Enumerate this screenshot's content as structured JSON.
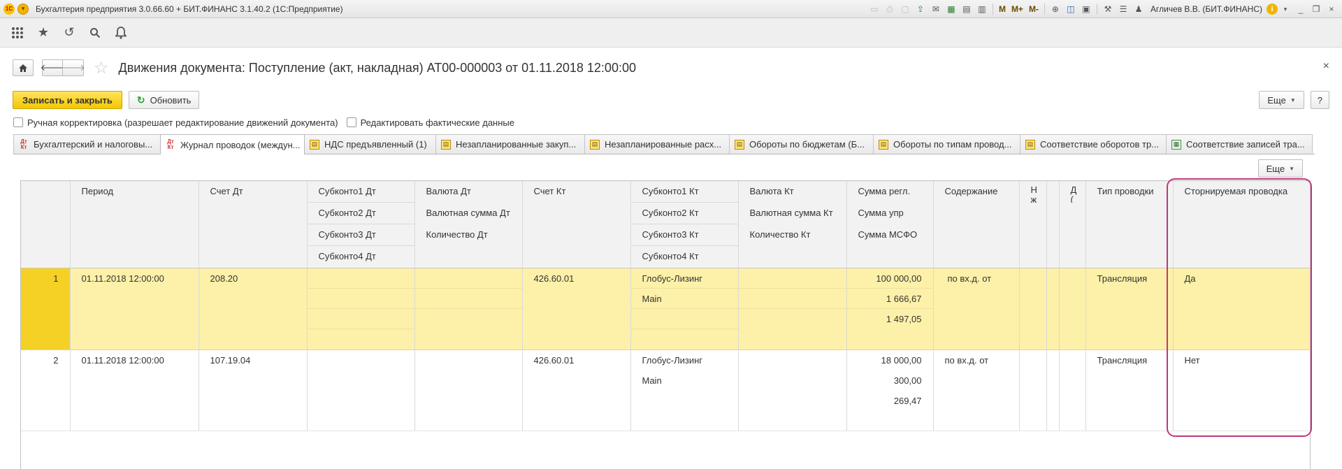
{
  "window": {
    "title": "Бухгалтерия предприятия 3.0.66.60 + БИТ.ФИНАНС 3.1.40.2  (1С:Предприятие)",
    "logo": "1С",
    "user": "Агличев В.В. (БИТ.ФИНАНС)",
    "m_buttons": [
      "M",
      "M+",
      "M-"
    ],
    "info": "i",
    "window_controls": [
      "_",
      "❐",
      "×"
    ]
  },
  "section_icons": [
    "apps-grid-icon",
    "star-icon",
    "history-icon",
    "search-icon",
    "bell-icon"
  ],
  "form": {
    "title": "Движения документа: Поступление (акт, накладная) АТ00-000003 от 01.11.2018 12:00:00",
    "close": "×"
  },
  "commands": {
    "save_close": "Записать и закрыть",
    "refresh": "Обновить",
    "more": "Еще",
    "help": "?"
  },
  "checkboxes": {
    "manual_adjust": "Ручная корректировка (разрешает редактирование движений документа)",
    "edit_actual": "Редактировать фактические данные"
  },
  "tabs": [
    {
      "label": "Бухгалтерский и налоговы...",
      "icon": "dtkt"
    },
    {
      "label": "Журнал проводок (междун...",
      "icon": "dtkt",
      "active": true
    },
    {
      "label": "НДС предъявленный (1)",
      "icon": "reg"
    },
    {
      "label": "Незапланированные закуп...",
      "icon": "reg"
    },
    {
      "label": "Незапланированные расх...",
      "icon": "reg"
    },
    {
      "label": "Обороты по бюджетам (Б...",
      "icon": "reg"
    },
    {
      "label": "Обороты по типам провод...",
      "icon": "reg"
    },
    {
      "label": "Соответствие оборотов тр...",
      "icon": "reg"
    },
    {
      "label": "Соответствие записей тра...",
      "icon": "acc"
    }
  ],
  "grid": {
    "more": "Еще",
    "headers": {
      "period": "Период",
      "account_dt": "Счет Дт",
      "subconto_dt": [
        "Субконто1 Дт",
        "Субконто2 Дт",
        "Субконто3 Дт",
        "Субконто4 Дт"
      ],
      "currency_dt": [
        "Валюта Дт",
        "Валютная сумма Дт",
        "Количество Дт"
      ],
      "account_kt": "Счет Кт",
      "subconto_kt": [
        "Субконто1 Кт",
        "Субконто2 Кт",
        "Субконто3 Кт",
        "Субконто4 Кт"
      ],
      "currency_kt": [
        "Валюта Кт",
        "Валютная сумма Кт",
        "Количество Кт"
      ],
      "sums": [
        "Сумма регл.",
        "Сумма упр",
        "Сумма МСФО"
      ],
      "content": "Содержание",
      "narrow1": "Н\nж",
      "narrow2": "",
      "narrow3": "Д\n(",
      "entry_type": "Тип проводки",
      "reversed_entry": "Сторнируемая проводка"
    },
    "rows": [
      {
        "n": "1",
        "period": "01.11.2018 12:00:00",
        "account_dt": "208.20",
        "account_kt": "426.60.01",
        "subconto_kt": [
          "Глобус-Лизинг",
          "Main",
          "",
          ""
        ],
        "sums": [
          "100 000,00",
          "1 666,67",
          "1 497,05"
        ],
        "content": "по вх.д.  от",
        "entry_type": "Трансляция",
        "reversed": "Да",
        "selected": true
      },
      {
        "n": "2",
        "period": "01.11.2018 12:00:00",
        "account_dt": "107.19.04",
        "account_kt": "426.60.01",
        "subconto_kt": [
          "Глобус-Лизинг",
          "Main",
          "",
          ""
        ],
        "sums": [
          "18 000,00",
          "300,00",
          "269,47"
        ],
        "content": "по вх.д.  от",
        "entry_type": "Трансляция",
        "reversed": "Нет",
        "selected": false
      }
    ]
  }
}
